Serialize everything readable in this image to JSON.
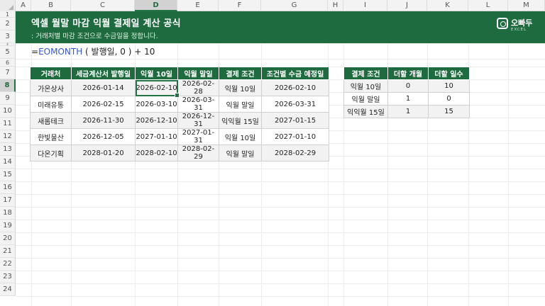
{
  "columns": [
    "A",
    "B",
    "C",
    "D",
    "E",
    "F",
    "G",
    "H",
    "I",
    "J",
    "K",
    "L",
    "M"
  ],
  "selected_column": "D",
  "rows": [
    "1",
    "2",
    "3",
    "4",
    "5",
    "6",
    "7",
    "8",
    "9",
    "10",
    "11",
    "12",
    "13",
    "14",
    "15",
    "16",
    "17",
    "18",
    "19",
    "20",
    "21",
    "22",
    "23",
    "24"
  ],
  "selected_row": "8",
  "banner": {
    "title": "엑셀 월말 마감 익월 결제일 계산 공식",
    "subtitle": ": 거래처별 마감 조건으로 수금일을 정합니다.",
    "logo_text": "오빠두",
    "logo_sub": "EXCEL"
  },
  "formula": {
    "prefix": "=",
    "function": "EOMONTH",
    "args": " ( 발행일, 0 ) + 10"
  },
  "main_table": {
    "headers": [
      "거래처",
      "세금계산서 발행일",
      "익월 10일",
      "익월 말일",
      "결제 조건",
      "조건별 수금 예정일"
    ],
    "rows": [
      [
        "가온상사",
        "2026-01-14",
        "2026-02-10",
        "2026-02-28",
        "익월 10일",
        "2026-02-10"
      ],
      [
        "미래유통",
        "2026-02-15",
        "2026-03-10",
        "2026-03-31",
        "익월 말일",
        "2026-03-31"
      ],
      [
        "새롬테크",
        "2026-11-30",
        "2026-12-10",
        "2026-12-31",
        "익익월 15일",
        "2027-01-15"
      ],
      [
        "한빛물산",
        "2026-12-05",
        "2027-01-10",
        "2027-01-31",
        "익월 10일",
        "2027-01-10"
      ],
      [
        "다온기획",
        "2028-01-20",
        "2028-02-10",
        "2028-02-29",
        "익월 말일",
        "2028-02-29"
      ]
    ]
  },
  "lookup_table": {
    "headers": [
      "결제 조건",
      "더할 개월",
      "더할 일수"
    ],
    "rows": [
      [
        "익월 10일",
        "0",
        "10"
      ],
      [
        "익월 말일",
        "1",
        "0"
      ],
      [
        "익익월 15일",
        "1",
        "15"
      ]
    ]
  }
}
